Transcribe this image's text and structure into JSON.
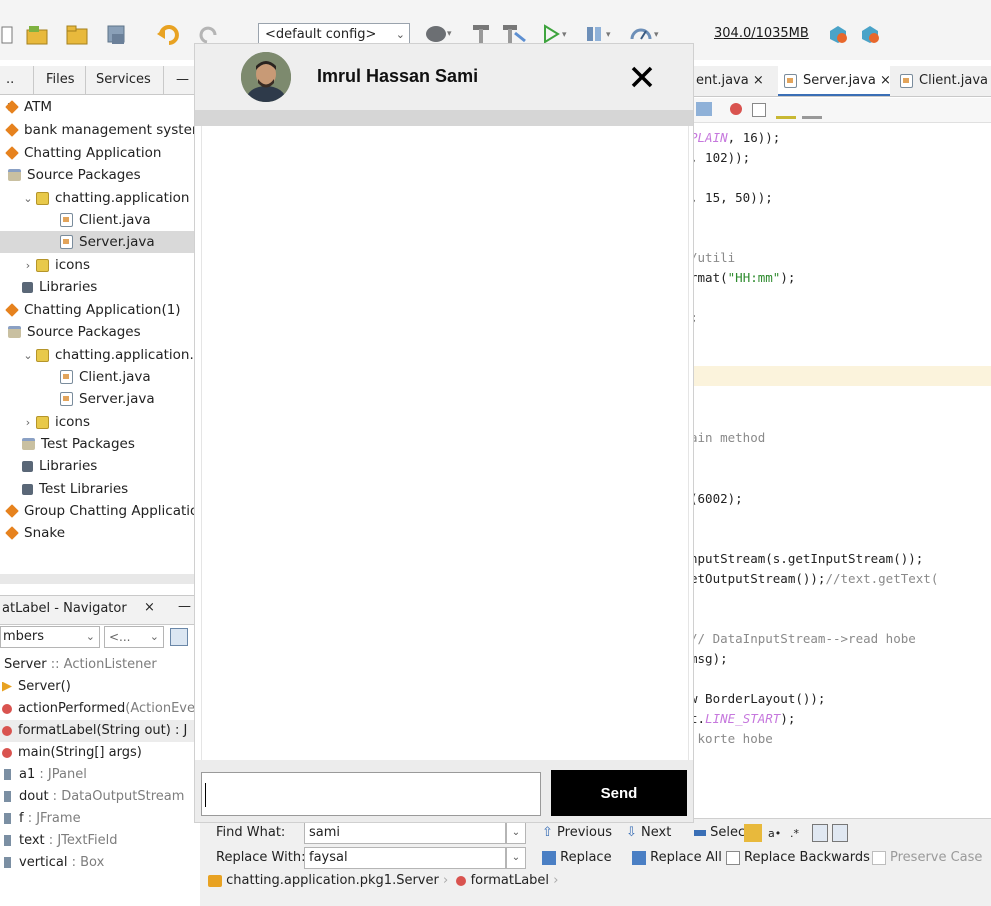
{
  "toolbar": {
    "config_value": "<default config>",
    "memory": "304.0/1035MB"
  },
  "project_panel": {
    "tabs": [
      "..",
      "Files",
      "Services"
    ],
    "tree": [
      {
        "label": "ATM",
        "icon": "project-icon"
      },
      {
        "label": "bank management system",
        "icon": "project-icon"
      },
      {
        "label": "Chatting Application",
        "icon": "project-icon"
      },
      {
        "label": "Source Packages",
        "icon": "source-folder-icon"
      },
      {
        "label": "chatting.application",
        "icon": "package-icon"
      },
      {
        "label": "Client.java",
        "icon": "java-file-icon"
      },
      {
        "label": "Server.java",
        "icon": "java-file-icon"
      },
      {
        "label": "icons",
        "icon": "package-icon"
      },
      {
        "label": "Libraries",
        "icon": "library-icon"
      },
      {
        "label": "Chatting Application(1)",
        "icon": "project-icon"
      },
      {
        "label": "Source Packages",
        "icon": "source-folder-icon"
      },
      {
        "label": "chatting.application.",
        "icon": "package-icon"
      },
      {
        "label": "Client.java",
        "icon": "java-file-icon"
      },
      {
        "label": "Server.java",
        "icon": "java-file-icon"
      },
      {
        "label": "icons",
        "icon": "package-icon"
      },
      {
        "label": "Test Packages",
        "icon": "source-folder-icon"
      },
      {
        "label": "Libraries",
        "icon": "library-icon"
      },
      {
        "label": "Test Libraries",
        "icon": "library-icon"
      },
      {
        "label": "Group Chatting Applicatio",
        "icon": "project-icon"
      },
      {
        "label": "Snake",
        "icon": "project-icon"
      }
    ]
  },
  "navigator": {
    "title": "atLabel - Navigator",
    "filter_left": "mbers",
    "filter_right": "<...",
    "class_line": {
      "name": "Server",
      "suffix": " :: ActionListener"
    },
    "members": [
      {
        "name": "Server()",
        "type": ""
      },
      {
        "name": "actionPerformed",
        "type": "(ActionEve"
      },
      {
        "name": "formatLabel(String out) : J",
        "type": ""
      },
      {
        "name": "main(String[] args)",
        "type": ""
      },
      {
        "name": "a1",
        "type": " : JPanel"
      },
      {
        "name": "dout",
        "type": " : DataOutputStream"
      },
      {
        "name": "f",
        "type": " : JFrame"
      },
      {
        "name": "text",
        "type": " : JTextField"
      },
      {
        "name": "vertical",
        "type": " : Box"
      }
    ]
  },
  "editor": {
    "tabs": [
      "ent.java",
      "Server.java",
      "Client.java"
    ],
    "code": [
      {
        "segments": [
          {
            "t": "PLAIN",
            "c": "kw-italic"
          },
          {
            "t": ", 16));",
            "c": ""
          }
        ]
      },
      {
        "segments": [
          {
            "t": ", 102));",
            "c": ""
          }
        ]
      },
      {
        "segments": [
          {
            "t": ", 15, 50));",
            "c": ""
          }
        ]
      },
      {
        "segments": [
          {
            "t": "/utili",
            "c": "cm"
          }
        ]
      },
      {
        "segments": [
          {
            "t": "rmat(",
            "c": ""
          },
          {
            "t": "\"HH:mm\"",
            "c": "str"
          },
          {
            "t": ");",
            "c": ""
          }
        ]
      },
      {
        "segments": [
          {
            "t": ";",
            "c": ""
          }
        ]
      },
      {
        "segments": [
          {
            "t": "ain method",
            "c": "cm"
          }
        ]
      },
      {
        "segments": [
          {
            "t": "(6002);",
            "c": ""
          }
        ]
      },
      {
        "segments": [
          {
            "t": "nputStream(s.getInputStream());",
            "c": ""
          }
        ]
      },
      {
        "segments": [
          {
            "t": "etOutputStream());",
            "c": ""
          },
          {
            "t": "//text.getText(",
            "c": "cm"
          }
        ]
      },
      {
        "segments": [
          {
            "t": "// DataInputStream-->read hobe",
            "c": "cm"
          }
        ]
      },
      {
        "segments": [
          {
            "t": "msg);",
            "c": ""
          }
        ]
      },
      {
        "segments": [
          {
            "t": "w BorderLayout());",
            "c": ""
          }
        ]
      },
      {
        "segments": [
          {
            "t": "t.",
            "c": ""
          },
          {
            "t": "LINE_START",
            "c": "kw-italic"
          },
          {
            "t": ");",
            "c": ""
          }
        ]
      },
      {
        "segments": [
          {
            "t": " korte hobe",
            "c": "cm"
          }
        ]
      }
    ]
  },
  "find_bar": {
    "find_label": "Find What:",
    "find_value": "sami",
    "replace_label": "Replace With:",
    "replace_value": "faysal",
    "previous": "Previous",
    "next": "Next",
    "select": "Select",
    "replace": "Replace",
    "replace_all": "Replace All",
    "replace_backwards": "Replace Backwards",
    "preserve_case": "Preserve Case",
    "crumb1": "chatting.application.pkg1.Server",
    "crumb2": "formatLabel"
  },
  "chat": {
    "name": "Imrul Hassan Sami",
    "send_label": "Send",
    "input_value": ""
  },
  "colors": {
    "send_bg": "#000000",
    "header_bg": "#eeeeee",
    "accent": "#3b6fb6"
  }
}
